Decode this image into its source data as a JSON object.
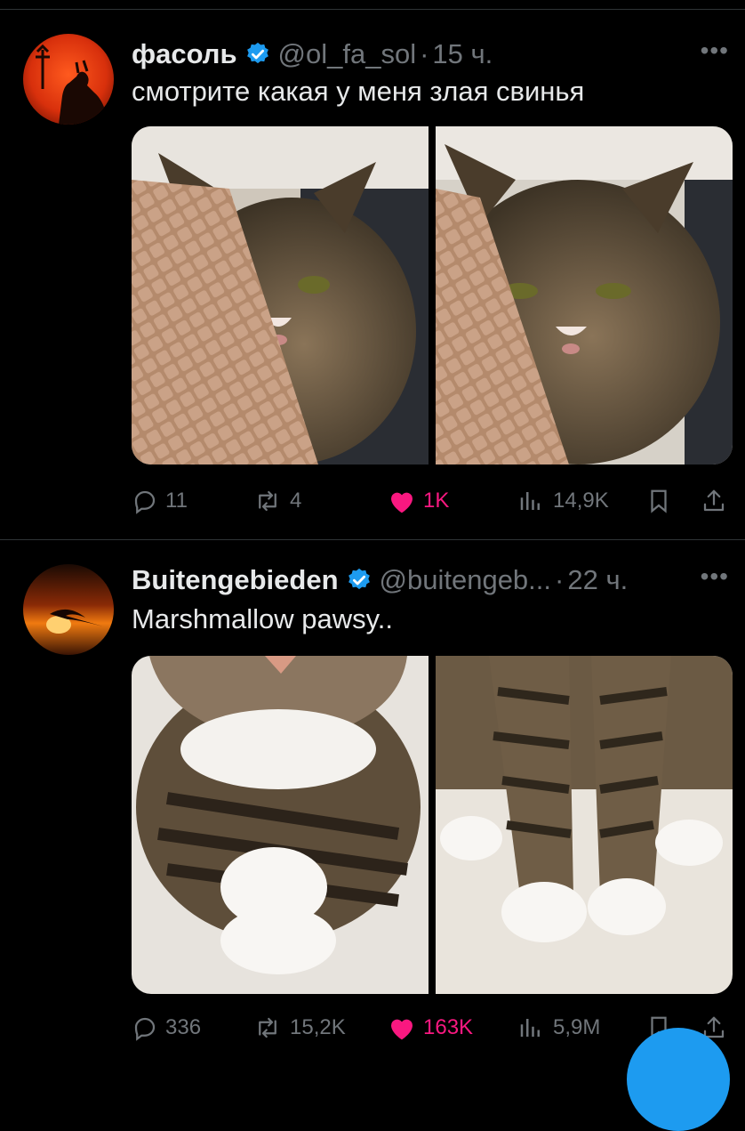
{
  "tweets": [
    {
      "display_name": "фасоль",
      "handle": "@ol_fa_sol",
      "separator": "·",
      "time": "15 ч.",
      "text": "смотрите какая у меня злая свинья",
      "stats": {
        "replies": "11",
        "retweets": "4",
        "likes": "1K",
        "views": "14,9K"
      },
      "liked": true
    },
    {
      "display_name": "Buitengebieden",
      "handle": "@buitengeb...",
      "separator": "·",
      "time": "22 ч.",
      "text": "Marshmallow pawsy..",
      "stats": {
        "replies": "336",
        "retweets": "15,2K",
        "likes": "163K",
        "views": "5,9M"
      },
      "liked": true
    }
  ],
  "more_icon": "more-dots-icon",
  "colors": {
    "background": "#000000",
    "like": "#f91880",
    "verified": "#1d9bf0",
    "muted": "#71767b",
    "text": "#e7e9ea"
  }
}
